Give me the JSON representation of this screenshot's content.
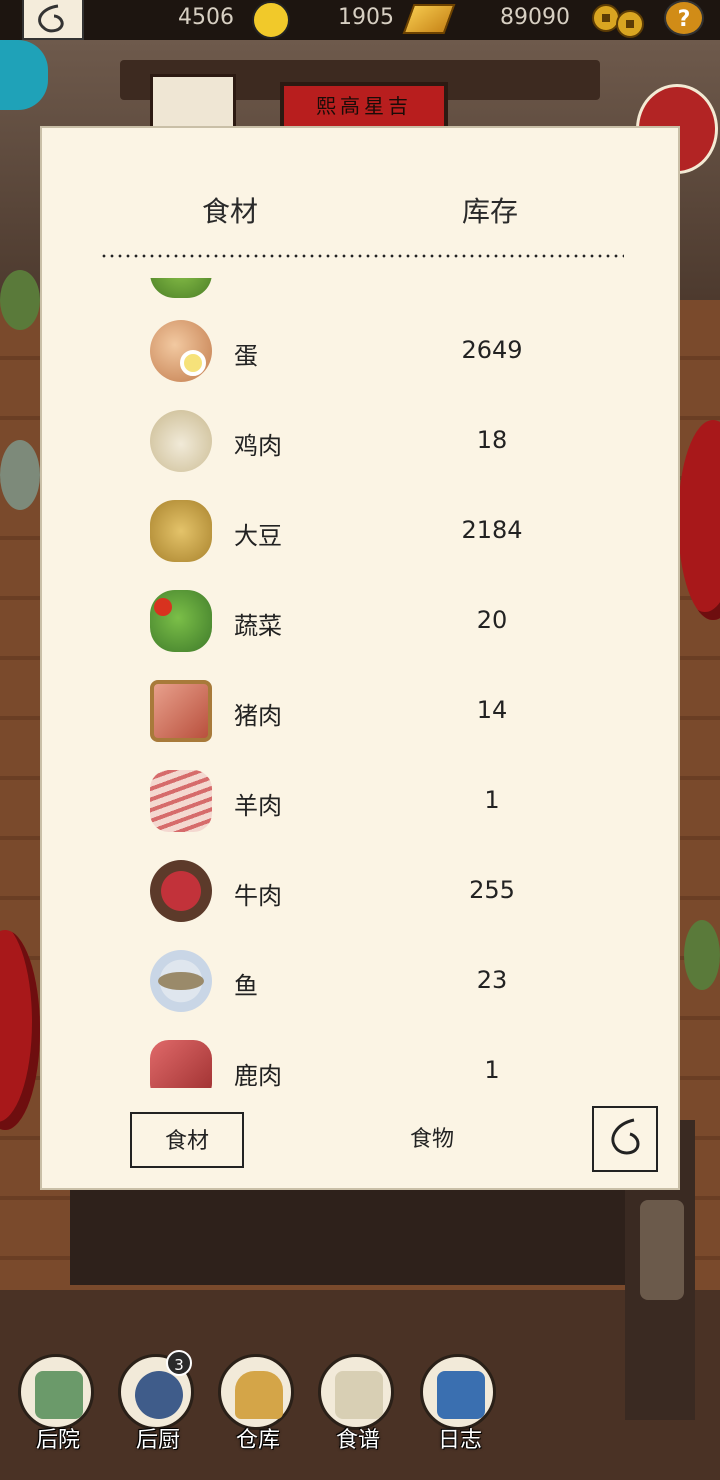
{
  "topbar": {
    "happiness": "4506",
    "gold": "1905",
    "coins": "89090",
    "help_label": "?"
  },
  "scene": {
    "sign_text": "熙高星吉"
  },
  "inventory": {
    "header_ingredient": "食材",
    "header_stock": "库存",
    "items": [
      {
        "name": "蛋",
        "count": "2649",
        "icon": "egg-icon"
      },
      {
        "name": "鸡肉",
        "count": "18",
        "icon": "chicken-icon"
      },
      {
        "name": "大豆",
        "count": "2184",
        "icon": "soybean-icon"
      },
      {
        "name": "蔬菜",
        "count": "20",
        "icon": "vegetable-icon"
      },
      {
        "name": "猪肉",
        "count": "14",
        "icon": "pork-icon"
      },
      {
        "name": "羊肉",
        "count": "1",
        "icon": "lamb-icon"
      },
      {
        "name": "牛肉",
        "count": "255",
        "icon": "beef-icon"
      },
      {
        "name": "鱼",
        "count": "23",
        "icon": "fish-icon"
      },
      {
        "name": "鹿肉",
        "count": "1",
        "icon": "venison-icon"
      }
    ],
    "tab_ingredients": "食材",
    "tab_food": "食物"
  },
  "nav": {
    "backyard": "后院",
    "kitchen": "后厨",
    "kitchen_badge": "3",
    "warehouse": "仓库",
    "recipes": "食谱",
    "log": "日志"
  },
  "colors": {
    "panel_bg": "#fbf4e4",
    "sign_red": "#b81e1e",
    "accent_gold": "#d18c17"
  }
}
